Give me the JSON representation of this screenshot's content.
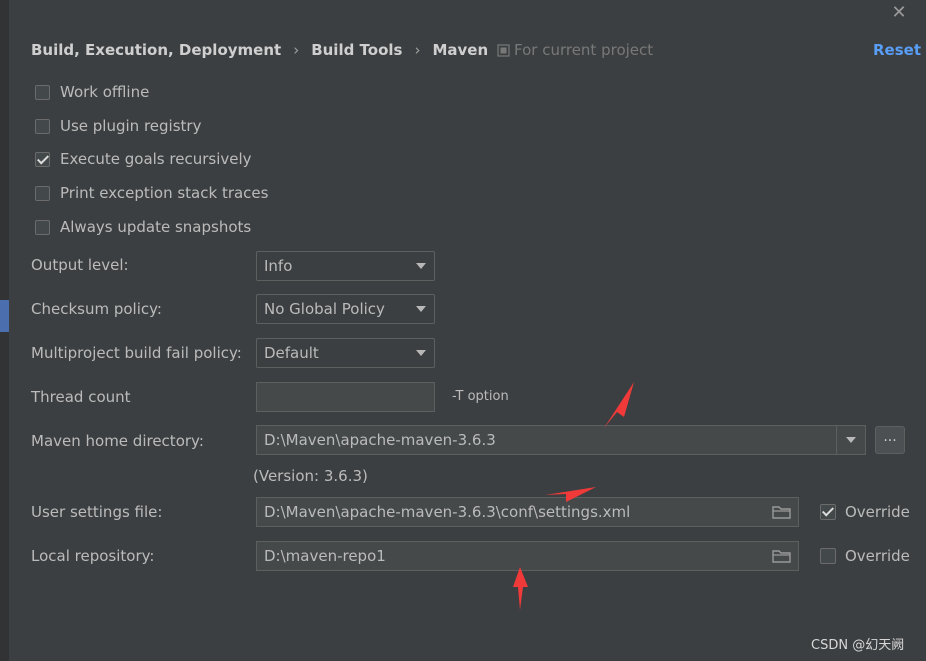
{
  "dialog": {
    "close_icon": "close-icon"
  },
  "breadcrumb": [
    "Build, Execution, Deployment",
    "Build Tools",
    "Maven"
  ],
  "breadcrumb_separator": "›",
  "scope": {
    "label": "For current project",
    "icon": "project-scope-icon"
  },
  "reset_label": "Reset",
  "checkboxes": [
    {
      "label": "Work offline",
      "checked": false
    },
    {
      "label": "Use plugin registry",
      "checked": false
    },
    {
      "label": "Execute goals recursively",
      "checked": true
    },
    {
      "label": "Print exception stack traces",
      "checked": false
    },
    {
      "label": "Always update snapshots",
      "checked": false
    }
  ],
  "output_level": {
    "label": "Output level:",
    "value": "Info"
  },
  "checksum_policy": {
    "label": "Checksum policy:",
    "value": "No Global Policy"
  },
  "multiproject_fail_policy": {
    "label": "Multiproject build fail policy:",
    "value": "Default"
  },
  "thread_count": {
    "label": "Thread count",
    "value": "",
    "hint": "-T option"
  },
  "maven_home": {
    "label": "Maven home directory:",
    "value": "D:\\Maven\\apache-maven-3.6.3",
    "version": "(Version: 3.6.3)",
    "browse_label": "..."
  },
  "user_settings": {
    "label": "User settings file:",
    "value": "D:\\Maven\\apache-maven-3.6.3\\conf\\settings.xml",
    "override_label": "Override",
    "override_checked": true
  },
  "local_repository": {
    "label": "Local repository:",
    "value": "D:\\maven-repo1",
    "override_label": "Override",
    "override_checked": false
  },
  "annotation_color": "#f03a3a",
  "watermark": "CSDN @幻天阙",
  "colors": {
    "background": "#3c3f41",
    "accent": "#589df6",
    "text": "#bbbbbb"
  }
}
